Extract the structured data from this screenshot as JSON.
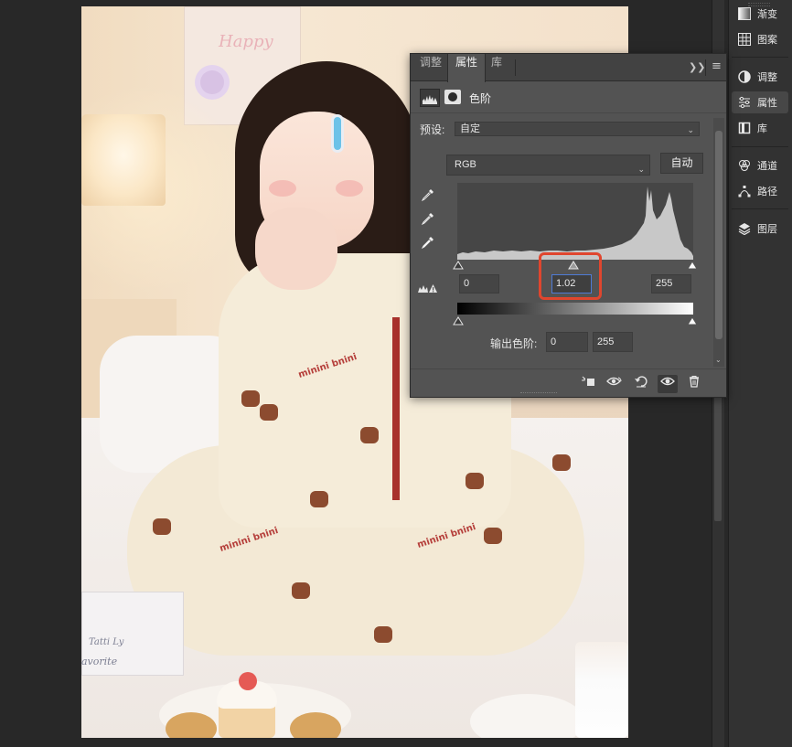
{
  "dock": {
    "items": [
      {
        "label": "渐变",
        "icon": "gradient-icon"
      },
      {
        "label": "图案",
        "icon": "pattern-icon"
      },
      {
        "label": "调整",
        "icon": "adjustments-icon"
      },
      {
        "label": "属性",
        "icon": "properties-icon"
      },
      {
        "label": "库",
        "icon": "libraries-icon"
      },
      {
        "label": "通道",
        "icon": "channels-icon"
      },
      {
        "label": "路径",
        "icon": "paths-icon"
      },
      {
        "label": "图层",
        "icon": "layers-icon"
      }
    ],
    "active": "属性"
  },
  "panel": {
    "tabs": [
      {
        "label": "调整"
      },
      {
        "label": "属性"
      },
      {
        "label": "库"
      }
    ],
    "active_tab": "属性",
    "adjustment_type": "色阶",
    "preset": {
      "label": "预设:",
      "value": "自定"
    },
    "channel": {
      "value": "RGB"
    },
    "auto_button": "自动",
    "input_levels": {
      "black": "0",
      "gamma": "1.02",
      "white": "255"
    },
    "output_levels": {
      "label": "输出色阶:",
      "black": "0",
      "white": "255"
    },
    "highlight_color": "#e0462e"
  },
  "photo": {
    "poster_text": "Happy",
    "print_text": "minini bnini",
    "book_text_1": "Tatti Ly",
    "book_text_2": "avorite"
  }
}
